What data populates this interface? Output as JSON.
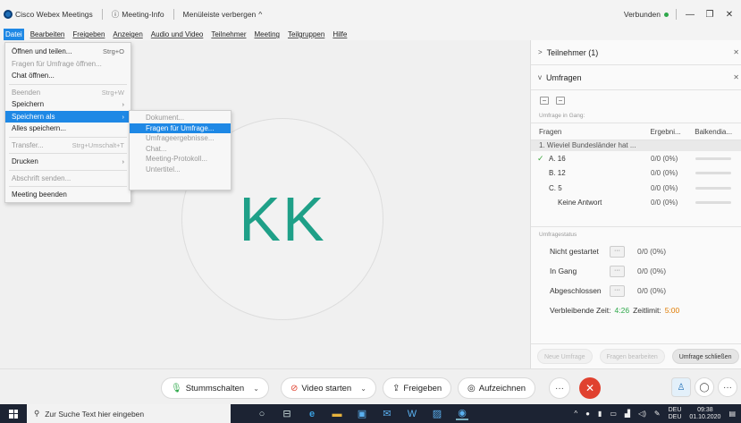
{
  "titlebar": {
    "app_name": "Cisco Webex Meetings",
    "meeting_info": "Meeting-Info",
    "hide_menu": "Menüleiste verbergen",
    "connected": "Verbunden"
  },
  "menubar": {
    "items": [
      "Datei",
      "Bearbeiten",
      "Freigeben",
      "Anzeigen",
      "Audio und Video",
      "Teilnehmer",
      "Meeting",
      "Teilgruppen",
      "Hilfe"
    ]
  },
  "file_menu": {
    "items": [
      {
        "label": "Öffnen und teilen...",
        "shortcut": "Strg+O"
      },
      {
        "label": "Fragen für Umfrage öffnen...",
        "shortcut": ""
      },
      {
        "label": "Chat öffnen...",
        "shortcut": ""
      },
      {
        "label": "Beenden",
        "shortcut": "Strg+W"
      },
      {
        "label": "Speichern",
        "shortcut": "›"
      },
      {
        "label": "Speichern als",
        "shortcut": "›"
      },
      {
        "label": "Alles speichern...",
        "shortcut": ""
      },
      {
        "label": "Transfer...",
        "shortcut": "Strg+Umschalt+T"
      },
      {
        "label": "Drucken",
        "shortcut": "›"
      },
      {
        "label": "Abschrift senden...",
        "shortcut": ""
      },
      {
        "label": "Meeting beenden",
        "shortcut": ""
      }
    ]
  },
  "save_as_menu": {
    "items": [
      "Dokument...",
      "Fragen für Umfrage...",
      "Umfrageergebnisse...",
      "Chat...",
      "Meeting-Protokoll...",
      "Untertitel..."
    ]
  },
  "stage": {
    "initials": "KK"
  },
  "panel": {
    "participants_header": "Teilnehmer (1)",
    "polls_header": "Umfragen",
    "poll_in_progress": "Umfrage in Gang:",
    "col_questions": "Fragen",
    "col_results": "Ergebni...",
    "col_bar": "Balkendia...",
    "question": "1. Wieviel Bundesländer hat ...",
    "answers": [
      {
        "label": "A.  16",
        "result": "0/0 (0%)"
      },
      {
        "label": "B.  12",
        "result": "0/0 (0%)"
      },
      {
        "label": "C.  5",
        "result": "0/0 (0%)"
      }
    ],
    "no_answer": "Keine Antwort",
    "no_answer_result": "0/0 (0%)",
    "status_label": "Umfragestatus",
    "status_rows": [
      {
        "label": "Nicht gestartet",
        "value": "0/0 (0%)"
      },
      {
        "label": "In Gang",
        "value": "0/0 (0%)"
      },
      {
        "label": "Abgeschlossen",
        "value": "0/0 (0%)"
      }
    ],
    "remaining_label": "Verbleibende Zeit:",
    "remaining_value": "4:26",
    "limit_label": "Zeitlimit:",
    "limit_value": "5:00",
    "btn_new": "Neue Umfrage",
    "btn_edit": "Fragen bearbeiten",
    "btn_close": "Umfrage schließen"
  },
  "controls": {
    "mute": "Stummschalten",
    "video": "Video starten",
    "share": "Freigeben",
    "record": "Aufzeichnen"
  },
  "taskbar": {
    "search_placeholder": "Zur Suche Text hier eingeben",
    "lang": "DEU",
    "lang_sub": "DEU",
    "time": "09:38",
    "date": "01.10.2020"
  },
  "colors": {
    "accent": "#1e88e5",
    "initials": "#1fa088",
    "end_button": "#e0412f",
    "time_green": "#2ea84a",
    "time_orange": "#e07b00"
  }
}
